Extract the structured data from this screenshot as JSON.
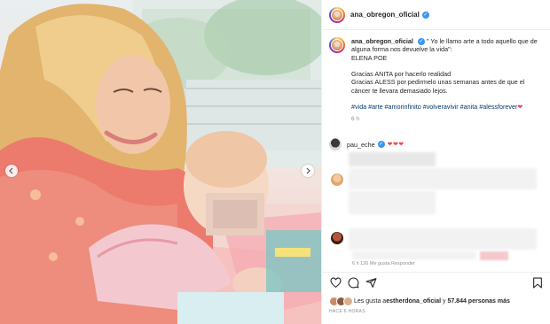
{
  "header": {
    "username": "ana_obregon_oficial"
  },
  "caption": {
    "username": "ana_obregon_oficial",
    "lines": [
      "\" Yo le llamo arte a todo aquello que de",
      "alguna forma nos devuelve la vida\":",
      "ELENA POE",
      "Gracias ANITA por hacerlo realidad",
      "Gracias ALESS por pedirmelo unas semanas antes de que el",
      "cáncer te llevara demasiado lejos."
    ],
    "hashtags": "#vida #arte #amorinfinito #volveravivir #anita #alessforever",
    "hashtag_heart": "❤",
    "time": "6 h"
  },
  "comments": [
    {
      "username": "pau_eche",
      "text": "❤❤❤"
    }
  ],
  "last_comment_meta": "6 h   126 Me gusta   Responder",
  "likes": {
    "prefix": "Les gusta a ",
    "user": "estherdona_oficial",
    "middle": " y ",
    "count": "57.844 personas más"
  },
  "posted_ago": "HACE 6 HORAS",
  "colors": {
    "verified": "#3897f0",
    "heart": "#ed4956",
    "hashtag": "#00376b"
  },
  "icons": [
    "chevron-left-icon",
    "chevron-right-icon",
    "heart-icon",
    "comment-icon",
    "share-icon",
    "bookmark-icon",
    "verified-icon"
  ]
}
